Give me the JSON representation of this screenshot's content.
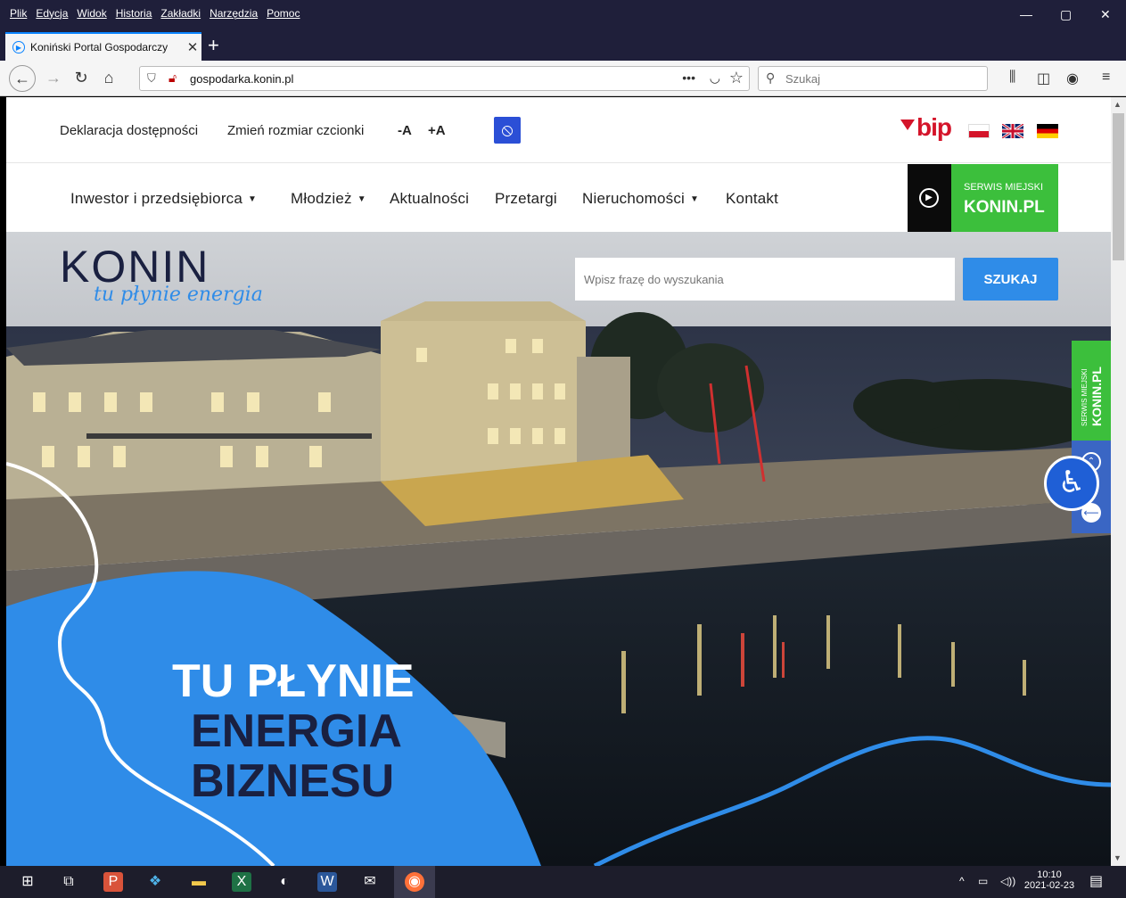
{
  "browser": {
    "menu": [
      "Plik",
      "Edycja",
      "Widok",
      "Historia",
      "Zakładki",
      "Narzędzia",
      "Pomoc"
    ],
    "tab_title": "Koniński Portal Gospodarczy",
    "tab_close": "✕",
    "new_tab": "+",
    "url": "gospodarka.konin.pl",
    "search_placeholder": "Szukaj",
    "win_min": "—",
    "win_restore": "▢",
    "win_close": "✕"
  },
  "site": {
    "topbar": {
      "accessibility_declaration": "Deklaracja dostępności",
      "font_size_label": "Zmień rozmiar czcionki",
      "font_smaller": "-A",
      "font_larger": "+A",
      "bip": "bip"
    },
    "nav": [
      {
        "label": "Inwestor i przedsiębiorca",
        "dropdown": true
      },
      {
        "label": "Młodzież",
        "dropdown": true
      },
      {
        "label": "Aktualności",
        "dropdown": false
      },
      {
        "label": "Przetargi",
        "dropdown": false
      },
      {
        "label": "Nieruchomości",
        "dropdown": true
      },
      {
        "label": "Kontakt",
        "dropdown": false
      }
    ],
    "serwis": {
      "line1": "SERWIS MIEJSKI",
      "line2": "KONIN.PL"
    },
    "logo": {
      "main": "KONIN",
      "script": "tu płynie energia"
    },
    "search": {
      "placeholder": "Wpisz frazę do wyszukania",
      "button": "SZUKAJ"
    },
    "hero": {
      "line1": "TU PŁYNIE",
      "line2": "ENERGIA",
      "line3": "BIZNESU"
    },
    "side_tab": {
      "line1": "SERWIS MIEJSKI",
      "line2": "KONIN.PL"
    }
  },
  "taskbar": {
    "time": "10:10",
    "date": "2021-02-23"
  },
  "colors": {
    "accent_blue": "#2f8ce8",
    "navy": "#1a2040",
    "green": "#3cbf3c",
    "bip_red": "#d4142a"
  }
}
